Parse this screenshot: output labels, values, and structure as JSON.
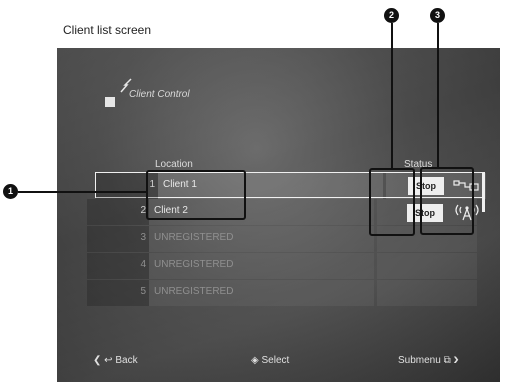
{
  "caption": "Client list screen",
  "app_title": "Client Control",
  "table": {
    "header_location": "Location",
    "header_status": "Status",
    "rows": [
      {
        "num": "1",
        "name": "Client 1",
        "status": "Stop"
      },
      {
        "num": "2",
        "name": "Client 2",
        "status": "Stop"
      },
      {
        "num": "3",
        "name": "UNREGISTERED"
      },
      {
        "num": "4",
        "name": "UNREGISTERED"
      },
      {
        "num": "5",
        "name": "UNREGISTERED"
      }
    ]
  },
  "callouts": [
    "1",
    "2",
    "3"
  ],
  "footer": {
    "back_label": "Back",
    "select_label": "Select",
    "submenu_label": "Submenu"
  },
  "icons": {
    "row1_status_icon": "wired-connection-icon",
    "row2_status_icon": "wireless-antenna-icon"
  }
}
